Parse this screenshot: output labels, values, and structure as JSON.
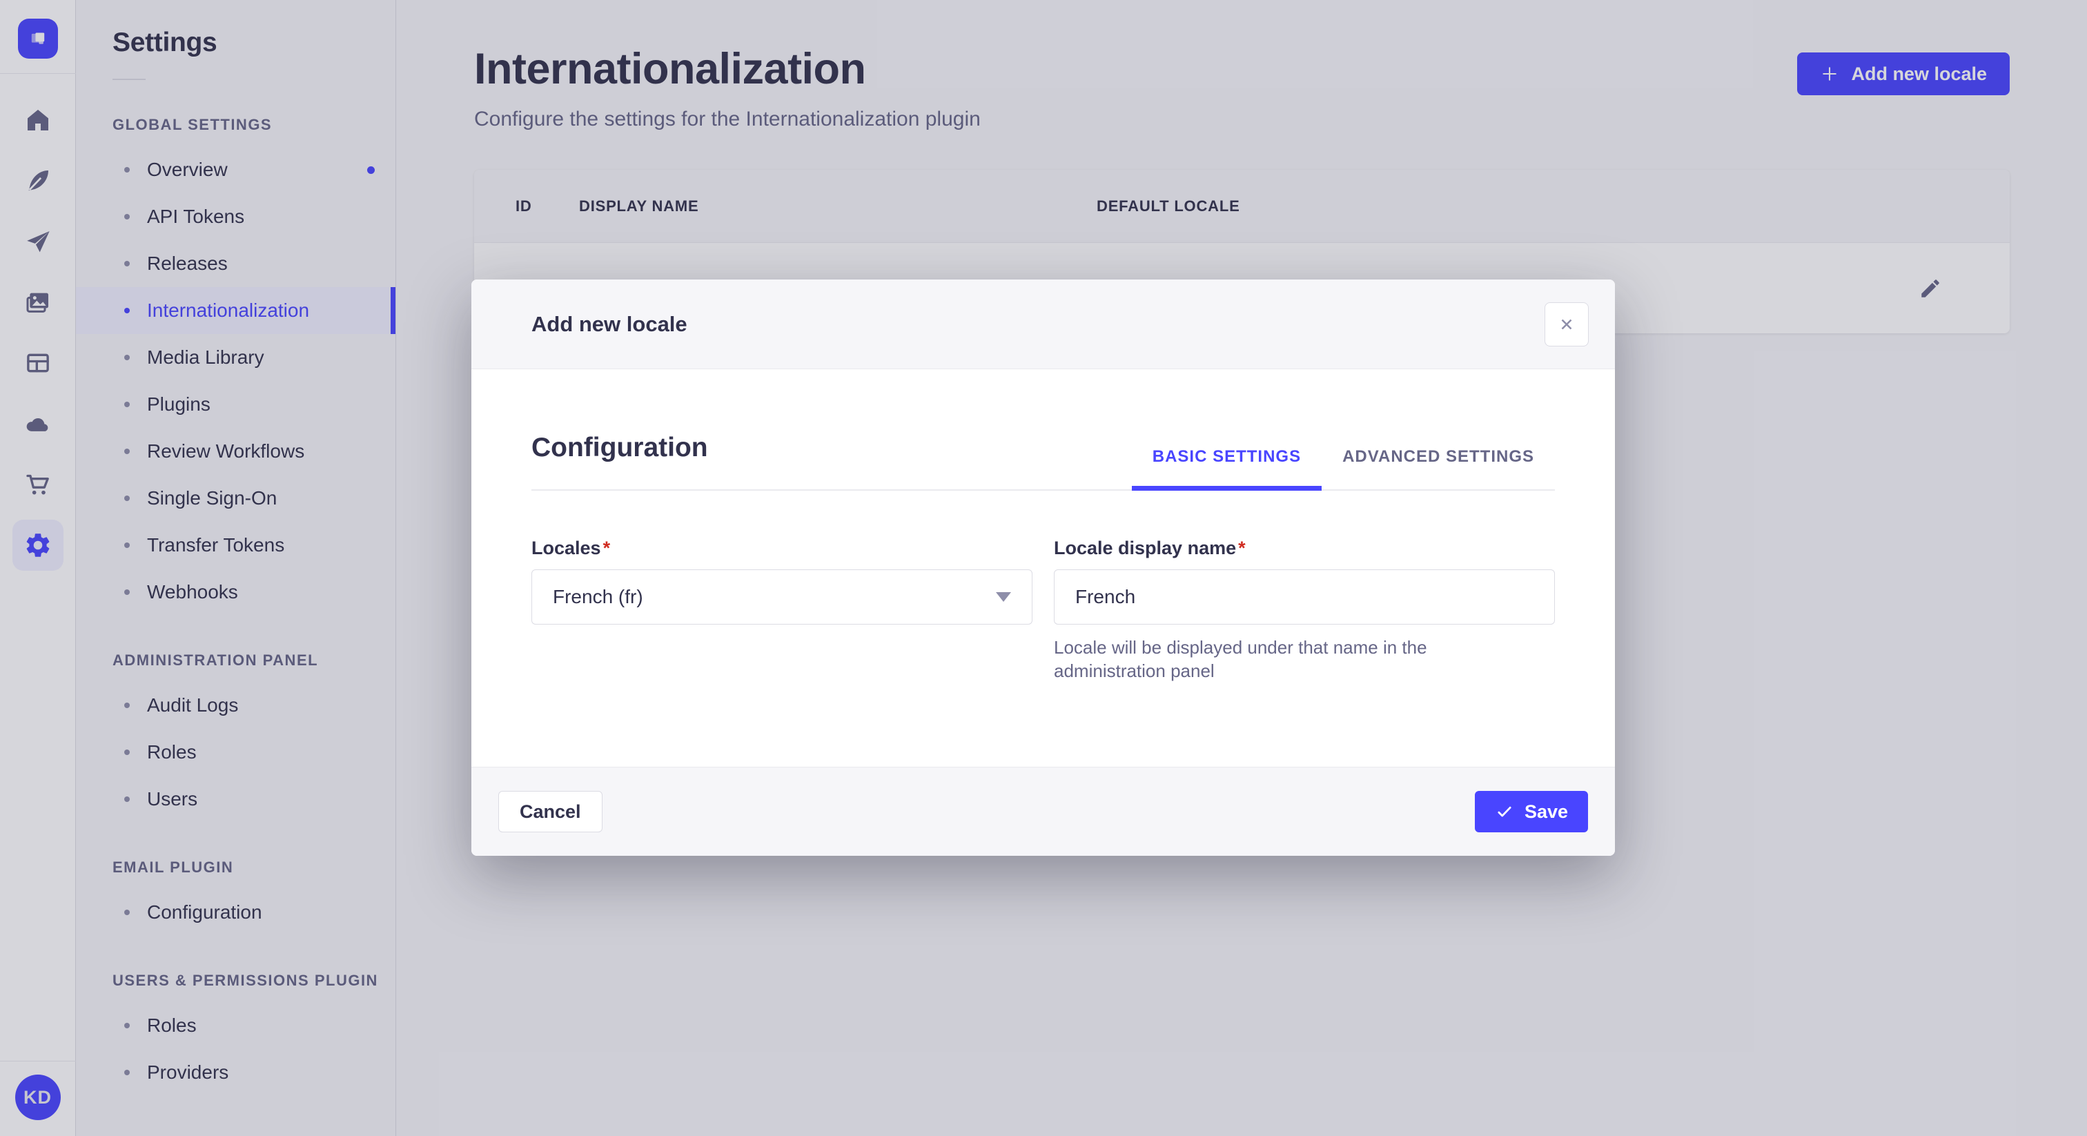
{
  "colors": {
    "primary": "#4945ff",
    "primary_light_bg": "#f0f0ff",
    "text": "#32324d",
    "muted": "#666687",
    "danger": "#d02b20",
    "border": "#dcdce4",
    "page_bg": "#f6f6f9"
  },
  "rail": {
    "avatar_initials": "KD"
  },
  "sidebar": {
    "title": "Settings",
    "sections": [
      {
        "label": "GLOBAL SETTINGS",
        "items": [
          {
            "label": "Overview"
          },
          {
            "label": "API Tokens"
          },
          {
            "label": "Releases"
          },
          {
            "label": "Internationalization"
          },
          {
            "label": "Media Library"
          },
          {
            "label": "Plugins"
          },
          {
            "label": "Review Workflows"
          },
          {
            "label": "Single Sign-On"
          },
          {
            "label": "Transfer Tokens"
          },
          {
            "label": "Webhooks"
          }
        ]
      },
      {
        "label": "ADMINISTRATION PANEL",
        "items": [
          {
            "label": "Audit Logs"
          },
          {
            "label": "Roles"
          },
          {
            "label": "Users"
          }
        ]
      },
      {
        "label": "EMAIL PLUGIN",
        "items": [
          {
            "label": "Configuration"
          }
        ]
      },
      {
        "label": "USERS & PERMISSIONS PLUGIN",
        "items": [
          {
            "label": "Roles"
          },
          {
            "label": "Providers"
          }
        ]
      }
    ]
  },
  "header": {
    "title": "Internationalization",
    "subtitle": "Configure the settings for the Internationalization plugin",
    "add_button_label": "Add new locale"
  },
  "table": {
    "columns": [
      "ID",
      "DISPLAY NAME",
      "DEFAULT LOCALE"
    ]
  },
  "modal": {
    "title": "Add new locale",
    "section_title": "Configuration",
    "tabs": [
      "BASIC SETTINGS",
      "ADVANCED SETTINGS"
    ],
    "active_tab": "BASIC SETTINGS",
    "required_mark": "*",
    "locales_label": "Locales",
    "locales_value": "French (fr)",
    "display_name_label": "Locale display name",
    "display_name_value": "French",
    "display_name_hint": "Locale will be displayed under that name in the administration panel",
    "cancel_label": "Cancel",
    "save_label": "Save"
  }
}
